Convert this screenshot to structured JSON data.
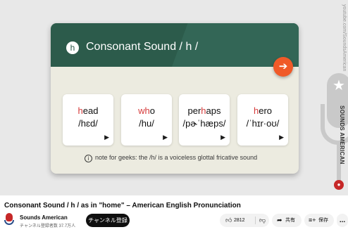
{
  "video": {
    "watermark": "youtube.com/SoundsAmerican",
    "brand_vertical": "SOUNDS AMERICAN",
    "card": {
      "badge": "h",
      "title": "Consonant Sound / h /",
      "next_icon": "arrow-right-icon",
      "words": [
        {
          "pre": "",
          "hl": "h",
          "post": "ead",
          "ipa": "/hɛd/"
        },
        {
          "pre": "",
          "hl": "wh",
          "post": "o",
          "ipa": "/hu/"
        },
        {
          "pre": "per",
          "hl": "h",
          "post": "aps",
          "ipa": "/pɚˈhæps/"
        },
        {
          "pre": "",
          "hl": "h",
          "post": "ero",
          "ipa": "/ˈhɪr·oʊ/"
        }
      ],
      "note": "note for geeks: the /h/ is a voiceless glottal fricative sound"
    }
  },
  "title": "Consonant Sound / h / as in \"home\" – American English Pronunciation",
  "channel": {
    "name": "Sounds American",
    "subs": "チャンネル登録者数 37.7万人",
    "subscribe_label": "チャンネル登録"
  },
  "actions": {
    "likes": "2812",
    "share_label": "共有",
    "save_label": "保存",
    "more": "..."
  },
  "colors": {
    "card_header": "#2c5b4b",
    "accent": "#f05a28",
    "highlight": "#d63b3b"
  }
}
